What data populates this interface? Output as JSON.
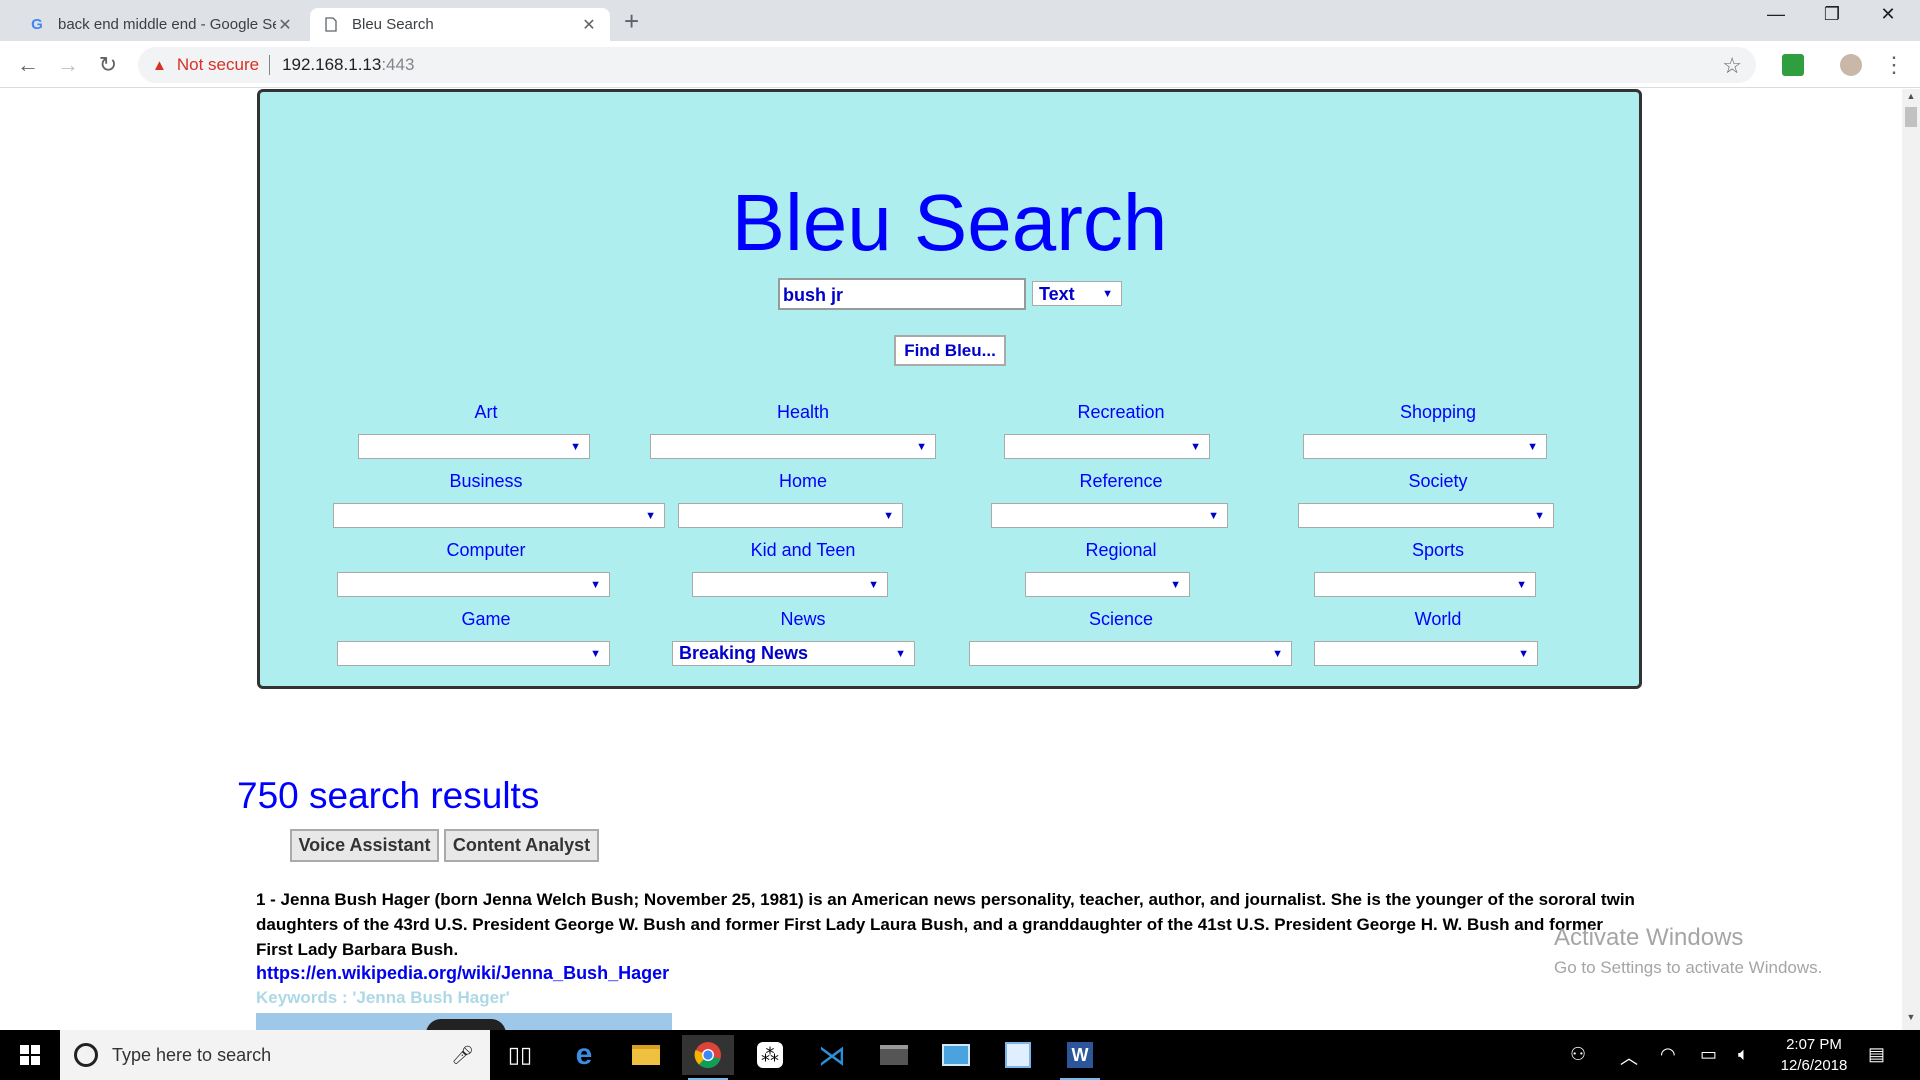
{
  "browser": {
    "tabs": [
      {
        "title": "back end middle end - Google Se",
        "favicon": "google-icon"
      },
      {
        "title": "Bleu Search",
        "favicon": "page-icon"
      }
    ],
    "security_label": "Not secure",
    "url_host": "192.168.1.13",
    "url_port": ":443"
  },
  "page": {
    "brand": "Bleu Search",
    "query": "bush jr",
    "search_type": "Text",
    "find_button": "Find Bleu...",
    "categories": [
      {
        "label": "Art",
        "selected": ""
      },
      {
        "label": "Health",
        "selected": ""
      },
      {
        "label": "Recreation",
        "selected": ""
      },
      {
        "label": "Shopping",
        "selected": ""
      },
      {
        "label": "Business",
        "selected": ""
      },
      {
        "label": "Home",
        "selected": ""
      },
      {
        "label": "Reference",
        "selected": ""
      },
      {
        "label": "Society",
        "selected": ""
      },
      {
        "label": "Computer",
        "selected": ""
      },
      {
        "label": "Kid and Teen",
        "selected": ""
      },
      {
        "label": "Regional",
        "selected": ""
      },
      {
        "label": "Sports",
        "selected": ""
      },
      {
        "label": "Game",
        "selected": ""
      },
      {
        "label": "News",
        "selected": "Breaking News"
      },
      {
        "label": "Science",
        "selected": ""
      },
      {
        "label": "World",
        "selected": ""
      }
    ],
    "results_count": "750 search results",
    "voice_assistant": "Voice Assistant",
    "content_analyst": "Content Analyst",
    "result1": {
      "text": "1 - Jenna Bush Hager (born Jenna Welch Bush; November 25, 1981) is an American news personality, teacher, author, and journalist. She is the younger of the sororal twin daughters of the 43rd U.S. President George W. Bush and former First Lady Laura Bush, and a granddaughter of the 41st U.S. President George H. W. Bush and former First Lady Barbara Bush.",
      "link": "https://en.wikipedia.org/wiki/Jenna_Bush_Hager",
      "keywords": "Keywords : 'Jenna Bush Hager'"
    },
    "watermark_title": "Activate Windows",
    "watermark_sub": "Go to Settings to activate Windows."
  },
  "taskbar": {
    "search_placeholder": "Type here to search",
    "time": "2:07 PM",
    "date": "12/6/2018"
  },
  "colors": {
    "panel_bg": "#afeeee",
    "brand_blue": "#0000ff",
    "control_text": "#0000cd"
  }
}
